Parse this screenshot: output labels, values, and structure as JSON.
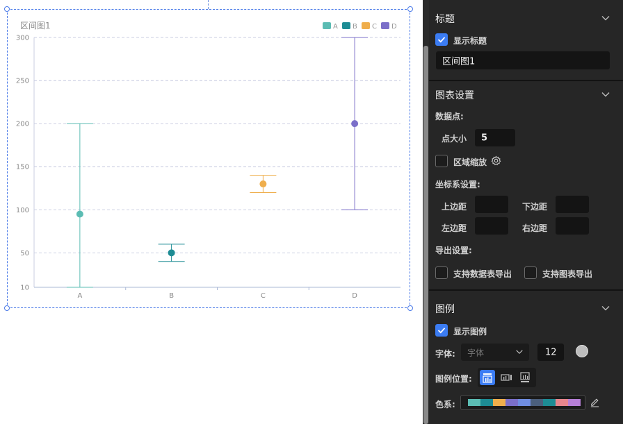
{
  "chart_data": {
    "type": "error-bar",
    "title": "区间图1",
    "categories": [
      "A",
      "B",
      "C",
      "D"
    ],
    "y_ticks": [
      300,
      250,
      200,
      150,
      100,
      50,
      10
    ],
    "ylim": [
      10,
      300
    ],
    "grid": true,
    "legend_placement": "top-right",
    "series": [
      {
        "name": "A",
        "color": "#5bbcb3",
        "low": 10,
        "high": 200,
        "value": 95
      },
      {
        "name": "B",
        "color": "#1d8c94",
        "low": 40,
        "high": 60,
        "value": 50
      },
      {
        "name": "C",
        "color": "#efae4c",
        "low": 120,
        "high": 140,
        "value": 130
      },
      {
        "name": "D",
        "color": "#7b6fc9",
        "low": 100,
        "high": 300,
        "value": 200
      }
    ]
  },
  "panel": {
    "title_section": {
      "header": "标题",
      "show_title_label": "显示标题",
      "show_title_checked": true,
      "title_value": "区间图1"
    },
    "chart_settings": {
      "header": "图表设置",
      "data_points_label": "数据点:",
      "point_size_label": "点大小",
      "point_size_value": "5",
      "zoom_label": "区域缩放",
      "zoom_checked": false,
      "coord_label": "坐标系设置:",
      "margin_top_label": "上边距",
      "margin_bottom_label": "下边距",
      "margin_left_label": "左边距",
      "margin_right_label": "右边距",
      "export_label": "导出设置:",
      "export_table_label": "支持数据表导出",
      "export_chart_label": "支持图表导出"
    },
    "legend_section": {
      "header": "图例",
      "show_legend_label": "显示图例",
      "show_legend_checked": true,
      "font_label": "字体:",
      "font_placeholder": "字体",
      "font_size_value": "12",
      "font_color": "#bdbdbd",
      "position_label": "图例位置:",
      "color_scheme_label": "色系:",
      "palette": [
        "#5bbcb3",
        "#1d8c94",
        "#efae4c",
        "#7b6fc9",
        "#6f8de0",
        "#4b5f7c",
        "#1d8c94",
        "#e7868d",
        "#b67fd6"
      ]
    }
  }
}
